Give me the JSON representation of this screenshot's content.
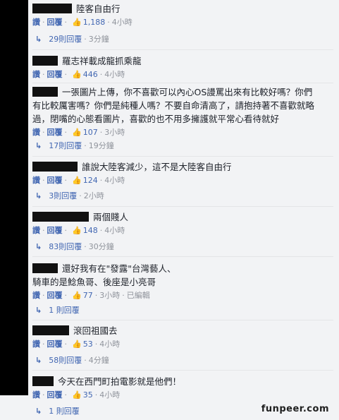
{
  "comments": [
    {
      "lines": [
        "陸客自由行"
      ],
      "reply": "回覆",
      "likes": "1,188",
      "time": "4小時",
      "replies": "29則回覆",
      "replies_time": "3分鐘"
    },
    {
      "lines": [
        "羅志祥載成龍抓乘龍"
      ],
      "reply": "回覆",
      "likes": "446",
      "time": "4小時"
    },
    {
      "lines": [
        "一張圖片上傳，你不喜歡可以內心OS謾罵出來有比較好嗎？你們",
        "有比較厲害嗎？你們是純種人嗎？不要自命清高了，請抱持著不喜歡就略",
        "過，閉嘴的心態看圖片，喜歡的也不用多擁護就平常心看待就好"
      ],
      "reply": "回覆",
      "likes": "107",
      "time": "3小時",
      "replies": "17則回覆",
      "replies_time": "19分鐘"
    },
    {
      "lines": [
        "誰說大陸客減少，這不是大陸客自由行"
      ],
      "reply": "回覆",
      "likes": "124",
      "time": "4小時",
      "replies": "3則回覆",
      "replies_time": "2小時"
    },
    {
      "lines": [
        "兩個賤人"
      ],
      "reply": "回覆",
      "likes": "148",
      "time": "4小時",
      "replies": "83則回覆",
      "replies_time": "30分鐘"
    },
    {
      "lines": [
        "還好我有在\"發露\"台灣藝人、",
        "騎車的是鯰魚哥、後座是小亮哥"
      ],
      "reply": "回覆",
      "likes": "77",
      "time": "3小時",
      "edited": "已編輯",
      "replies": "1 則回覆"
    },
    {
      "lines": [
        "滾回祖國去"
      ],
      "reply": "回覆",
      "likes": "53",
      "time": "4小時",
      "replies": "58則回覆",
      "replies_time": "4分鐘"
    },
    {
      "lines": [
        "今天在西門町拍電影就是他們！"
      ],
      "reply": "回覆",
      "likes": "35",
      "time": "4小時",
      "replies": "1 則回覆"
    }
  ],
  "ui": {
    "like_label": "讚",
    "like_icon": "thumbs-up-icon",
    "reply_arrow_icon": "reply-arrow-icon"
  },
  "watermark": "funpeer.com",
  "colors": {
    "link": "#4267b2",
    "muted": "#90949c",
    "background": "#f2f3f5"
  }
}
